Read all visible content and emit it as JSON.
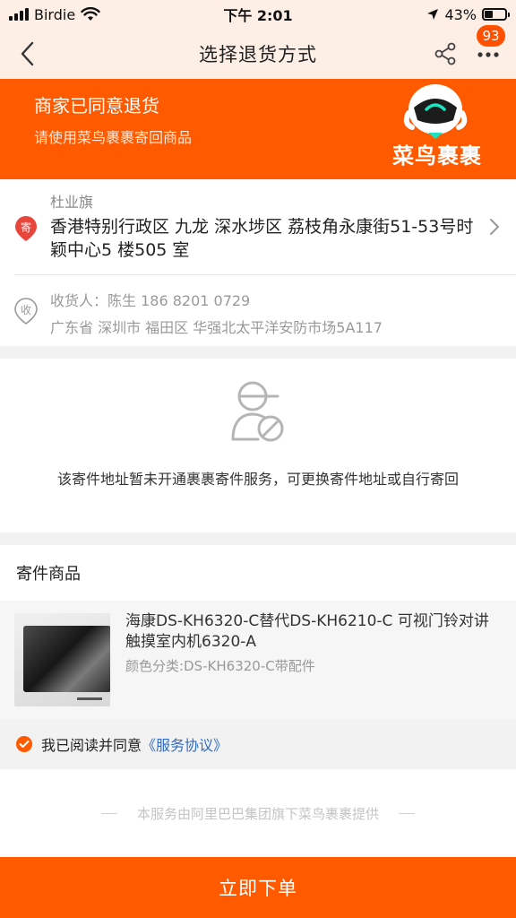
{
  "status_bar": {
    "carrier": "Birdie",
    "time": "下午 2:01",
    "battery": "43%",
    "battery_level": 0.43
  },
  "nav": {
    "title": "选择退货方式",
    "badge_count": "93"
  },
  "banner": {
    "title": "商家已同意退货",
    "subtitle": "请使用菜鸟裹裹寄回商品",
    "brand": "菜鸟裹裹",
    "accent_color": "#ff5a00"
  },
  "sender": {
    "icon_label": "寄",
    "name": "杜业旗",
    "address": "香港特别行政区 九龙 深水埗区 荔枝角永康街51-53号时颖中心5 楼505 室"
  },
  "receiver": {
    "icon_label": "收",
    "name_phone": "收货人：陈生  186 8201 0729",
    "address": "广东省 深圳市 福田区 华强北太平洋安防市场5A117"
  },
  "notice": {
    "text": "该寄件地址暂未开通裹裹寄件服务，可更换寄件地址或自行寄回"
  },
  "goods": {
    "section_title": "寄件商品",
    "items": [
      {
        "name": "海康DS-KH6320-C替代DS-KH6210-C 可视门铃对讲触摸室内机6320-A",
        "spec": "颜色分类:DS-KH6320-C带配件"
      }
    ]
  },
  "agreement": {
    "checked": true,
    "text": "我已阅读并同意",
    "link": "《服务协议》"
  },
  "footer": {
    "note": "本服务由阿里巴巴集团旗下菜鸟裹裹提供"
  },
  "submit": {
    "label": "立即下单"
  }
}
